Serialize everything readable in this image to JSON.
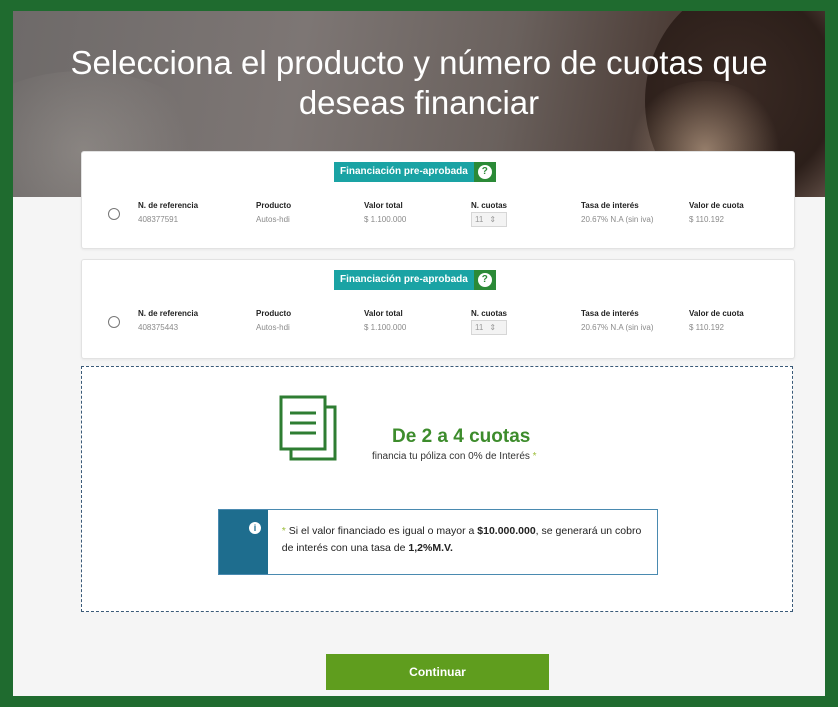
{
  "title": "Selecciona el producto y número de cuotas que deseas financiar",
  "badge": {
    "label": "Financiación pre-aprobada",
    "help": "?"
  },
  "headers": {
    "ref": "N. de referencia",
    "product": "Producto",
    "total": "Valor total",
    "cuotas": "N. cuotas",
    "rate": "Tasa de interés",
    "cuota_value": "Valor de cuota"
  },
  "options": [
    {
      "ref": "408377591",
      "product": "Autos-hdi",
      "total": "$ 1.100.000",
      "cuotas": "11",
      "rate": "20.67% N.A (sin iva)",
      "cuota_value": "$ 110.192"
    },
    {
      "ref": "408375443",
      "product": "Autos-hdi",
      "total": "$ 1.100.000",
      "cuotas": "11",
      "rate": "20.67% N.A (sin iva)",
      "cuota_value": "$ 110.192"
    }
  ],
  "promo": {
    "title": "De 2 a 4 cuotas",
    "subtitle": "financia tu póliza con 0% de Interés",
    "asterisk": "*"
  },
  "notice": {
    "icon": "i",
    "asterisk": "*",
    "text_before": " Si el valor financiado es igual o mayor a ",
    "amount": "$10.000.000",
    "text_middle": ", se generará un cobro de interés con una tasa de ",
    "rate": "1,2%M.V."
  },
  "continue_label": "Continuar",
  "colors": {
    "frame": "#1f6b2f",
    "badge": "#1aa3a4",
    "promo_title": "#3d8c2c",
    "notice_side": "#1e6d8e",
    "button": "#5f9d1e"
  }
}
